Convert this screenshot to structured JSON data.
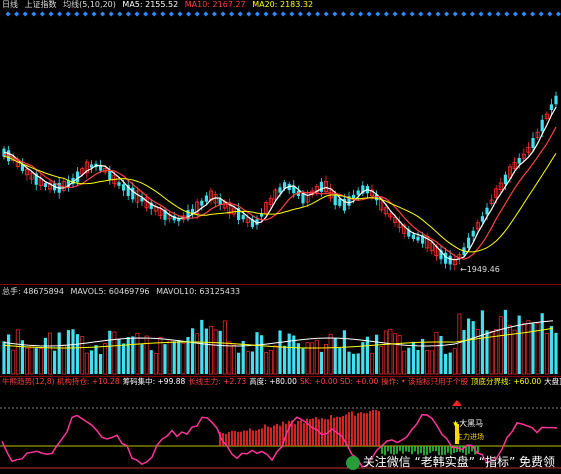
{
  "price_panel": {
    "period": "日线",
    "index_name": "上证指数",
    "ma_label": "均线(5,10,20)",
    "ma5": "MA5: 2155.52",
    "ma10": "MA10: 2167.27",
    "ma20": "MA20: 2183.32",
    "low_marker": "1949.46"
  },
  "volume_panel": {
    "label": "总手: 48675894",
    "mavol5": "MAVOL5: 60469796",
    "mavol10": "MAVOL10: 63125433"
  },
  "indicator_panel": {
    "items": [
      {
        "text": "牛熊趋势(12,8) 机构持仓: +10.28",
        "color": "#ff4040"
      },
      {
        "text": "筹码集中: +99.88",
        "color": "#ffffff"
      },
      {
        "text": "长线主力: +2.73",
        "color": "#ff4040"
      },
      {
        "text": "高度: +80.00",
        "color": "#ffffff"
      },
      {
        "text": "SK: +0.00 SD: +0.00",
        "color": "#ff4040"
      },
      {
        "text": "操作: • 该指标只用于个股",
        "color": "#ff4040"
      },
      {
        "text": "顶底分界线: +60.00",
        "color": "#ffff00"
      },
      {
        "text": "大盘顶",
        "color": "#ffffff"
      }
    ],
    "signal_label": "大黑马",
    "signal_sub": "主力进场"
  },
  "watermark": {
    "icon": "wechat-icon",
    "text": "关注微信 “老韩实盘” “指标” 免费领"
  },
  "colors": {
    "up": "#ff3030",
    "down": "#40e0f0",
    "ma5": "#ffffff",
    "ma10": "#ffff00",
    "ma20": "#ff4040",
    "signal": "#2e8bff"
  }
}
